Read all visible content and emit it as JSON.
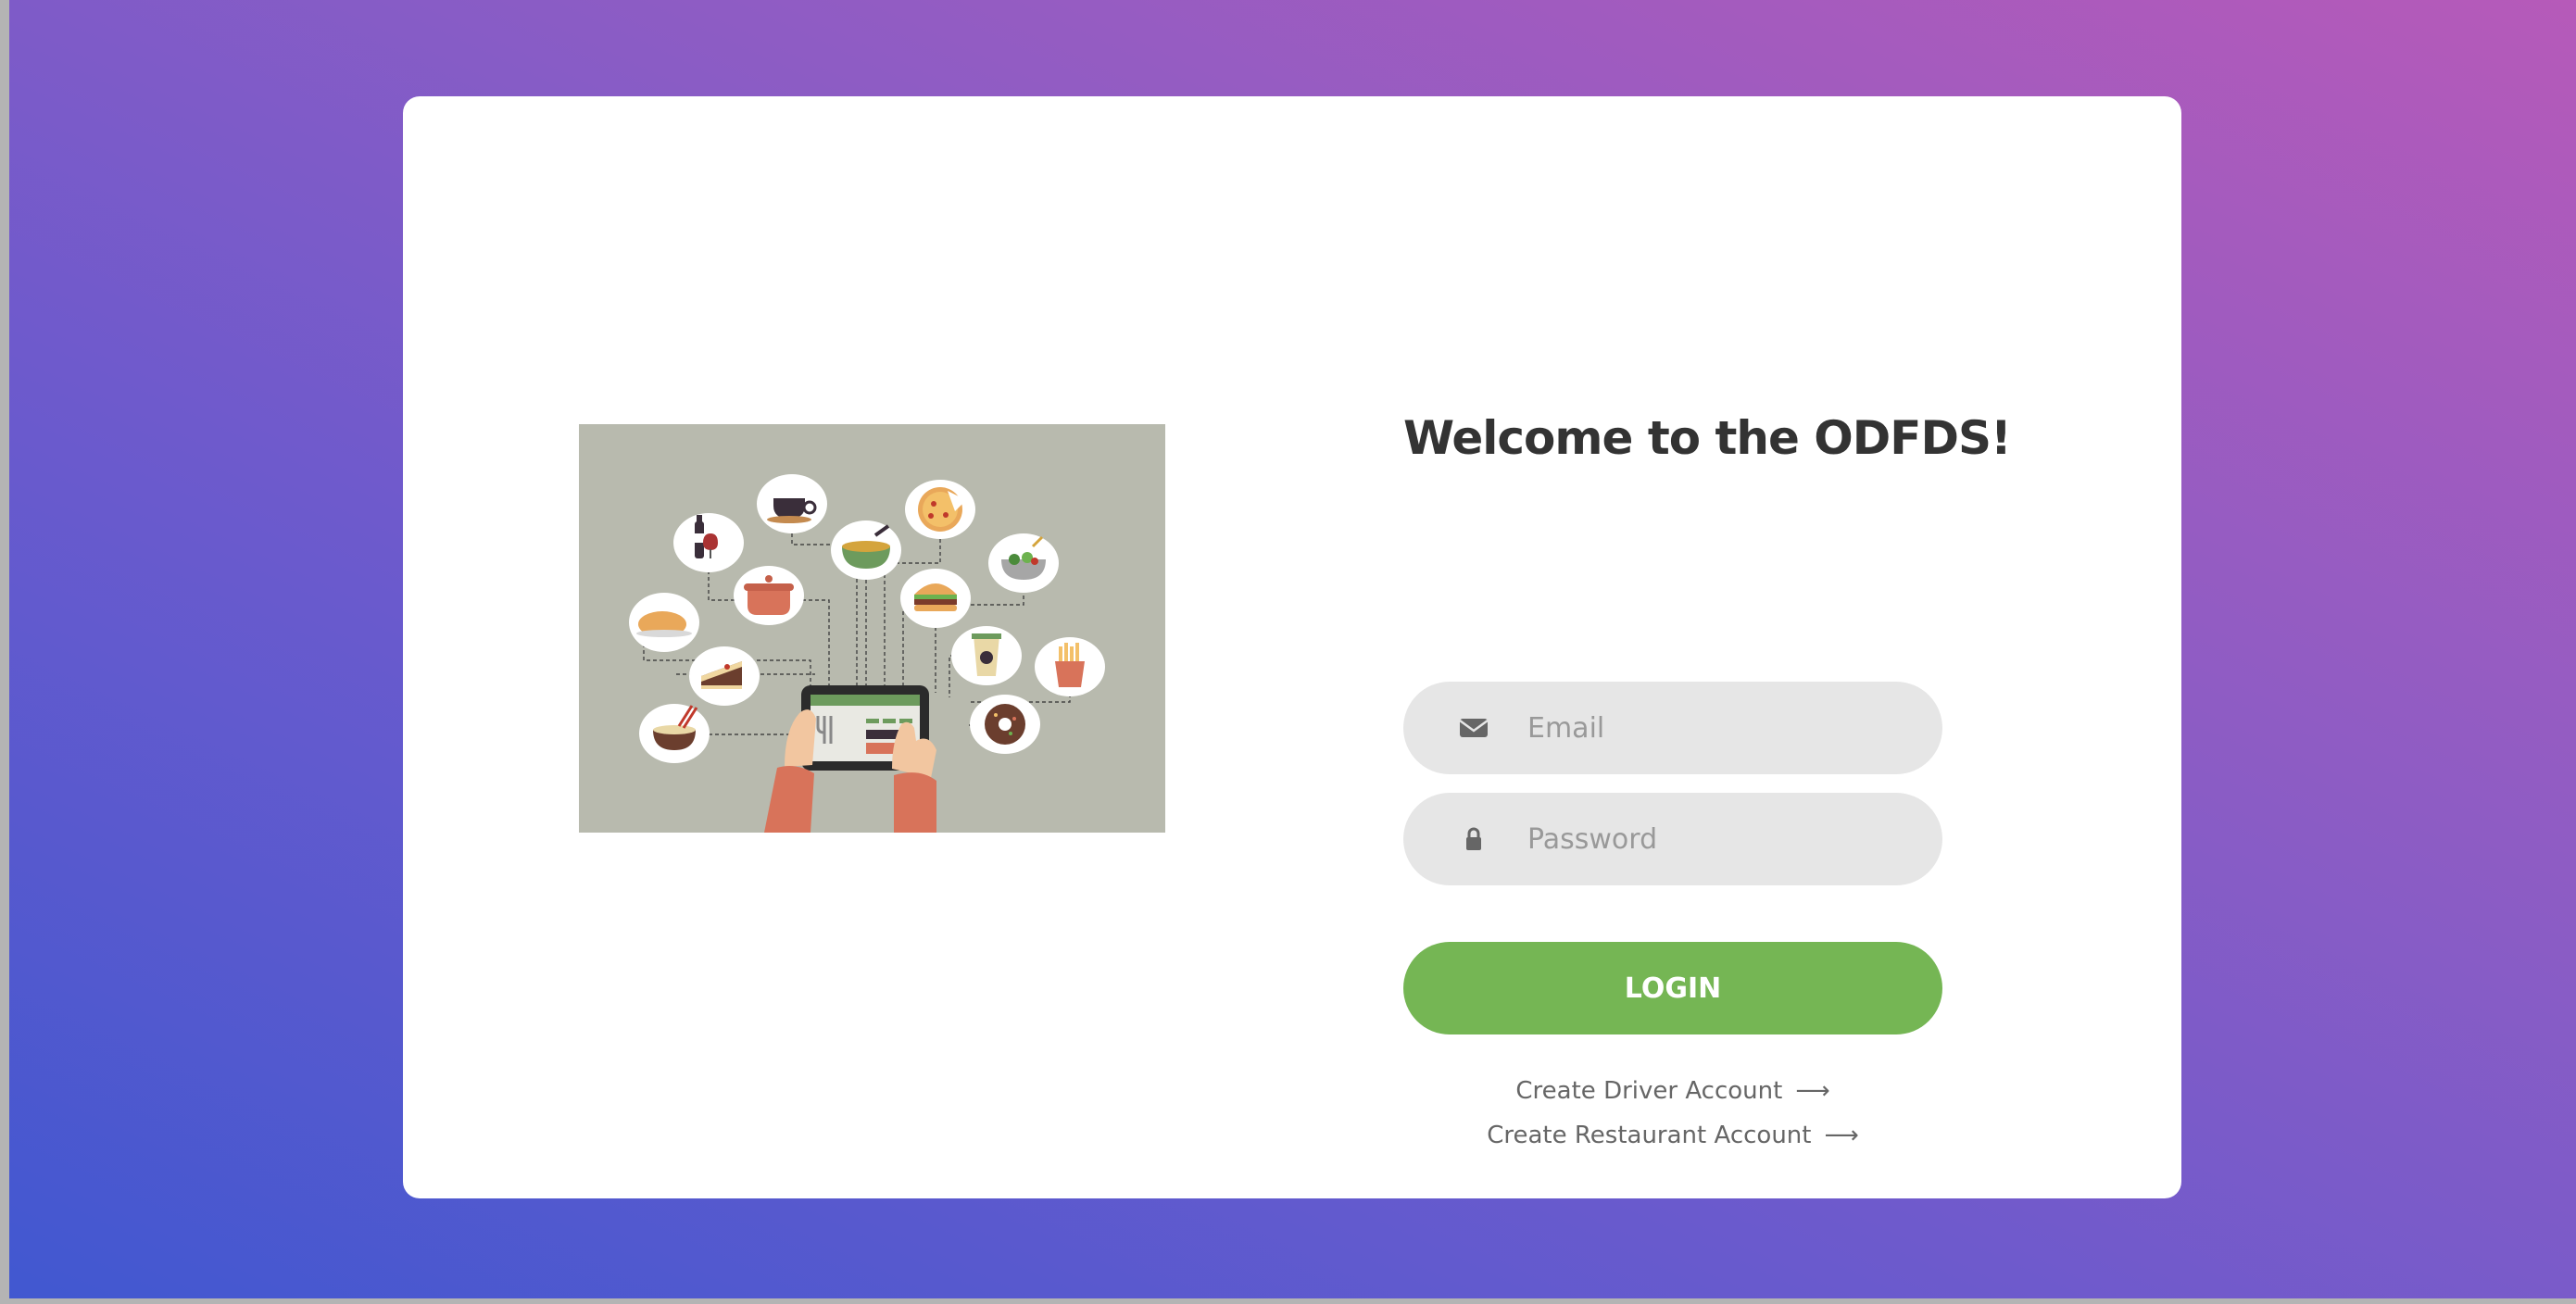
{
  "page": {
    "title": "Welcome to the ODFDS!"
  },
  "illustration": {
    "icon": "food-ordering-tablet-illustration"
  },
  "form": {
    "email": {
      "placeholder": "Email",
      "icon": "envelope-icon"
    },
    "password": {
      "placeholder": "Password",
      "icon": "lock-icon"
    },
    "login_label": "LOGIN"
  },
  "links": {
    "driver": "Create Driver Account",
    "restaurant": "Create Restaurant Account",
    "arrow": "⟶"
  },
  "colors": {
    "accent": "#75b654",
    "gradient_start": "#4158d0",
    "gradient_end": "#b65ab9"
  }
}
